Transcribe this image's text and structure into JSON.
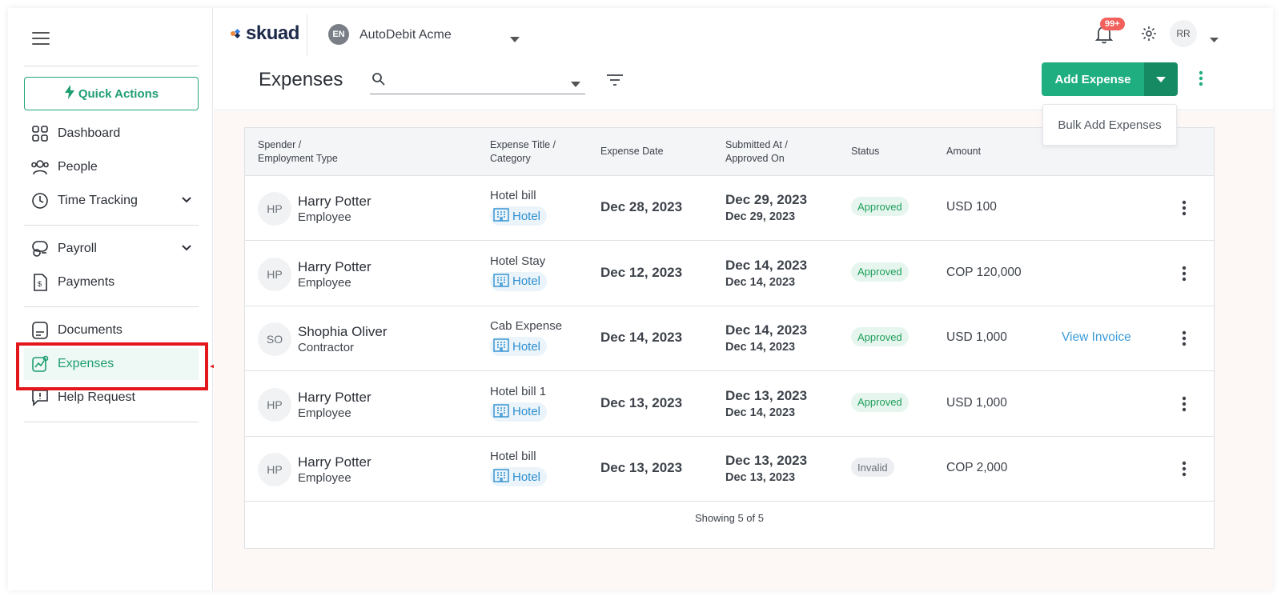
{
  "sidebar": {
    "quick_actions": "Quick Actions",
    "items": [
      {
        "label": "Dashboard"
      },
      {
        "label": "People"
      },
      {
        "label": "Time Tracking"
      },
      {
        "label": "Payroll"
      },
      {
        "label": "Payments"
      },
      {
        "label": "Documents"
      },
      {
        "label": "Expenses"
      },
      {
        "label": "Help Request"
      }
    ],
    "active": "Expenses"
  },
  "header": {
    "logo": "skuad",
    "org_badge": "EN",
    "org_name": "AutoDebit Acme",
    "notification_count": "99+",
    "user_initials": "RR"
  },
  "page": {
    "title": "Expenses",
    "search_placeholder": "",
    "add_expense_label": "Add Expense",
    "bulk_add_label": "Bulk Add Expenses"
  },
  "table": {
    "headers": {
      "spender_1": "Spender /",
      "spender_2": "Employment Type",
      "title_1": "Expense Title /",
      "title_2": "Category",
      "date": "Expense Date",
      "submitted_1": "Submitted At /",
      "submitted_2": "Approved On",
      "status": "Status",
      "amount": "Amount"
    },
    "rows": [
      {
        "initials": "HP",
        "name": "Harry Potter",
        "type": "Employee",
        "title": "Hotel bill",
        "category": "Hotel",
        "date": "Dec 28, 2023",
        "submitted": "Dec 29, 2023",
        "approved": "Dec 29, 2023",
        "status": "Approved",
        "amount": "USD 100",
        "invoice": ""
      },
      {
        "initials": "HP",
        "name": "Harry Potter",
        "type": "Employee",
        "title": "Hotel Stay",
        "category": "Hotel",
        "date": "Dec 12, 2023",
        "submitted": "Dec 14, 2023",
        "approved": "Dec 14, 2023",
        "status": "Approved",
        "amount": "COP 120,000",
        "invoice": ""
      },
      {
        "initials": "SO",
        "name": "Shophia Oliver",
        "type": "Contractor",
        "title": "Cab Expense",
        "category": "Hotel",
        "date": "Dec 14, 2023",
        "submitted": "Dec 14, 2023",
        "approved": "Dec 14, 2023",
        "status": "Approved",
        "amount": "USD 1,000",
        "invoice": "View Invoice"
      },
      {
        "initials": "HP",
        "name": "Harry Potter",
        "type": "Employee",
        "title": "Hotel bill 1",
        "category": "Hotel",
        "date": "Dec 13, 2023",
        "submitted": "Dec 13, 2023",
        "approved": "Dec 14, 2023",
        "status": "Approved",
        "amount": "USD 1,000",
        "invoice": ""
      },
      {
        "initials": "HP",
        "name": "Harry Potter",
        "type": "Employee",
        "title": "Hotel bill",
        "category": "Hotel",
        "date": "Dec 13, 2023",
        "submitted": "Dec 13, 2023",
        "approved": "Dec 13, 2023",
        "status": "Invalid",
        "amount": "COP 2,000",
        "invoice": ""
      }
    ],
    "footer": "Showing 5 of 5"
  },
  "colors": {
    "brand_green": "#1fae80",
    "highlight_red": "#e3171b",
    "link_blue": "#3a9bd8"
  }
}
